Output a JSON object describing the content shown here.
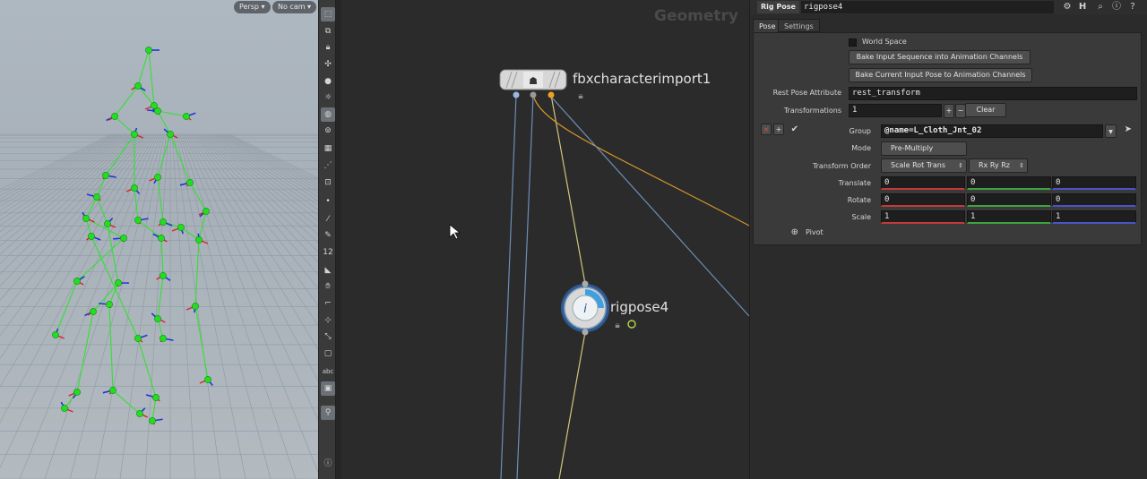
{
  "viewport": {
    "persp_menu": "Persp",
    "cam_menu": "No cam"
  },
  "toolbar": {
    "icons": [
      "select-icon",
      "box-select-icon",
      "lock-icon",
      "pose-icon",
      "sphere-icon",
      "light-icon",
      "snap-icon",
      "magnet-icon",
      "shading-icon",
      "grid-icon",
      "display-icon",
      "dot-icon",
      "brush-icon",
      "pen-icon",
      "number-icon",
      "fill-icon",
      "hand-icon",
      "ruler-icon",
      "transform-icon",
      "pivot-icon",
      "cube-icon",
      "abc-icon",
      "camera-icon",
      "pin-icon",
      "info-icon"
    ],
    "abc_label": "abc",
    "number_label": "12"
  },
  "network": {
    "context_title": "Geometry",
    "nodes": [
      {
        "name": "fbxcharacterimport1"
      },
      {
        "name": "rigpose4"
      }
    ],
    "wire_colors": {
      "blue": "#6e8db8",
      "orange": "#d89a2a",
      "yellow": "#cfc77a",
      "gray": "#8a95a0"
    }
  },
  "params": {
    "node_type": "Rig Pose",
    "node_name": "rigpose4",
    "tabs": [
      {
        "label": "Pose",
        "active": true
      },
      {
        "label": "Settings",
        "active": false
      }
    ],
    "world_space_label": "World Space",
    "bake_sequence_button": "Bake Input Sequence into Animation Channels",
    "bake_current_button": "Bake Current Input Pose to Animation Channels",
    "rest_pose_attribute": {
      "label": "Rest Pose Attribute",
      "value": "rest_transform"
    },
    "transformations": {
      "label": "Transformations",
      "value": "1",
      "add": "+",
      "remove": "−",
      "clear": "Clear"
    },
    "multiparm_remove": "×",
    "multiparm_insert": "+",
    "group": {
      "label": "Group",
      "value": "@name=L_Cloth_Jnt_02"
    },
    "mode": {
      "label": "Mode",
      "value": "Pre-Multiply"
    },
    "transform_order": {
      "label": "Transform Order",
      "value": "Scale Rot Trans",
      "rot_value": "Rx Ry Rz"
    },
    "translate": {
      "label": "Translate",
      "values": [
        "0",
        "0",
        "0"
      ]
    },
    "rotate": {
      "label": "Rotate",
      "values": [
        "0",
        "0",
        "0"
      ]
    },
    "scale": {
      "label": "Scale",
      "values": [
        "1",
        "1",
        "1"
      ]
    },
    "pivot": {
      "label": "Pivot"
    }
  },
  "accent_colors": {
    "x_axis": "#c23a3a",
    "y_axis": "#3fa33f",
    "z_axis": "#4a53c9",
    "joint": "#22dd22"
  }
}
